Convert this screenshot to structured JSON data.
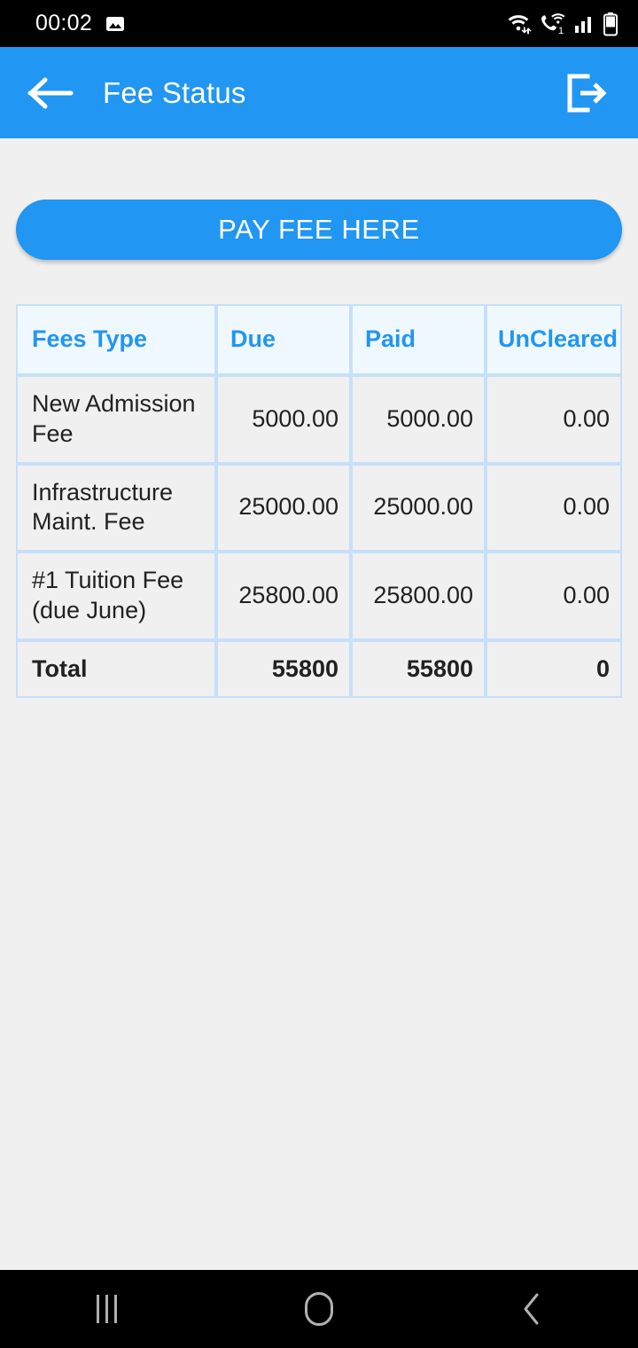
{
  "status_bar": {
    "time": "00:02",
    "left_icons": [
      "photo-icon"
    ],
    "right_icons": [
      "wifi-data-icon",
      "wifi-calling-icon",
      "signal-bars-icon",
      "battery-icon"
    ],
    "sim_label": "1",
    "background": "#000000"
  },
  "app_bar": {
    "title": "Fee Status",
    "back_icon": "arrow-left-icon",
    "logout_icon": "logout-icon",
    "background": "#2196f3",
    "text_color": "#ffffff"
  },
  "main": {
    "pay_button_label": "PAY FEE HERE",
    "accent_color": "#2196f3",
    "table": {
      "headers": [
        "Fees Type",
        "Due",
        "Paid",
        "UnCleared"
      ],
      "header_text_color": "#2196f3",
      "header_background": "#f0f8ff",
      "border_color": "#c6e0fa",
      "cell_background": "#f0f0f0",
      "rows": [
        {
          "type": "New Admission Fee",
          "due": "5000.00",
          "paid": "5000.00",
          "uncleared": "0.00"
        },
        {
          "type": "Infrastructure Maint. Fee",
          "due": "25000.00",
          "paid": "25000.00",
          "uncleared": "0.00"
        },
        {
          "type": "#1 Tuition Fee (due June)",
          "due": "25800.00",
          "paid": "25800.00",
          "uncleared": "0.00"
        }
      ],
      "total": {
        "type": "Total",
        "due": "55800",
        "paid": "55800",
        "uncleared": "0"
      }
    }
  },
  "nav_bar": {
    "recents_icon": "recents-icon",
    "home_icon": "home-icon",
    "back_icon": "nav-back-icon",
    "background": "#000000"
  }
}
